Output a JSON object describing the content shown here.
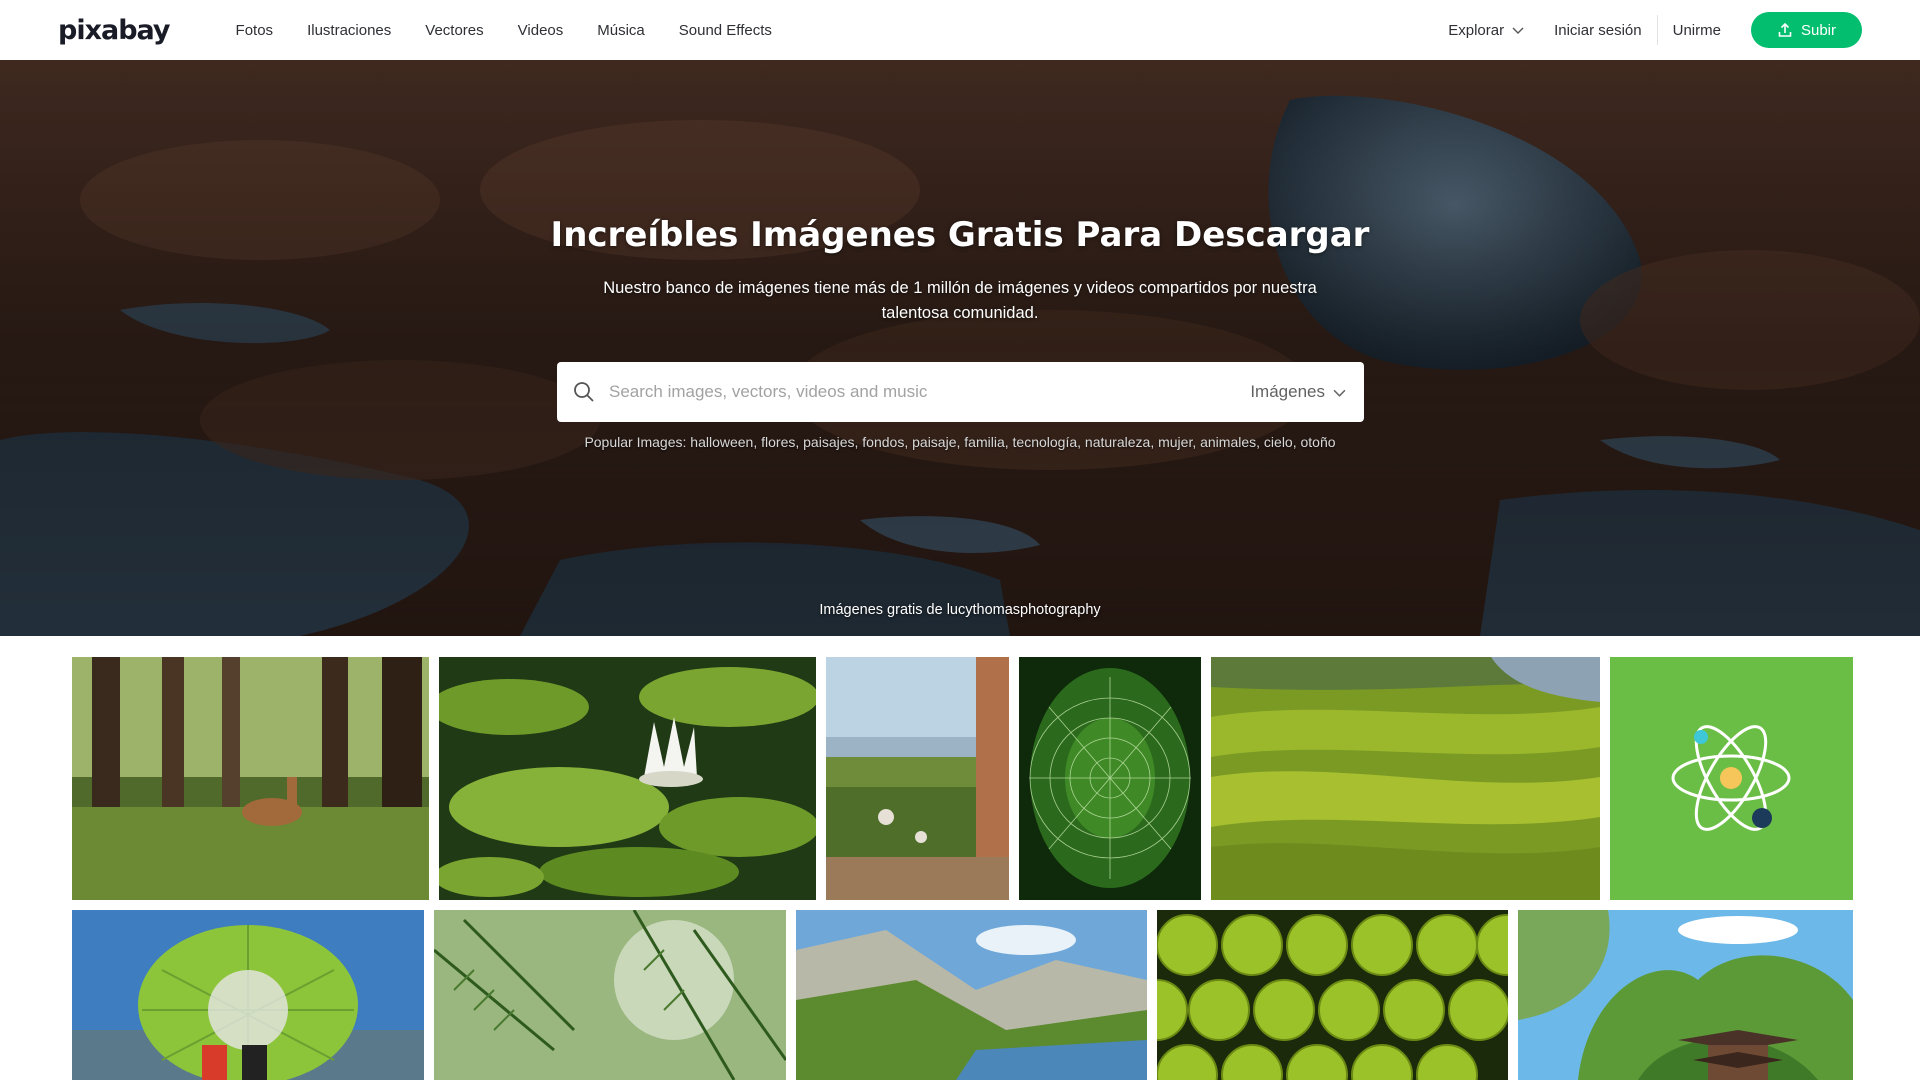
{
  "header": {
    "logo": "pixabay",
    "nav": [
      "Fotos",
      "Ilustraciones",
      "Vectores",
      "Videos",
      "Música",
      "Sound Effects"
    ],
    "explore_label": "Explorar",
    "login_label": "Iniciar sesión",
    "join_label": "Unirme",
    "upload_label": "Subir"
  },
  "hero": {
    "title": "Increíbles Imágenes Gratis Para Descargar",
    "subtitle": "Nuestro banco de imágenes tiene más de 1 millón de imágenes y videos compartidos por nuestra talentosa comunidad.",
    "search": {
      "placeholder": "Search images, vectors, videos and music",
      "type_label": "Imágenes"
    },
    "popular_prefix": "Popular Images:",
    "popular_tags": [
      "halloween",
      "flores",
      "paisajes",
      "fondos",
      "paisaje",
      "familia",
      "tecnología",
      "naturaleza",
      "mujer",
      "animales",
      "cielo",
      "otoño"
    ],
    "credit": "Imágenes gratis de lucythomasphotography"
  },
  "gallery": {
    "thumbnails": [
      "forest-deer",
      "water-lily",
      "valley-view",
      "spider-web",
      "rice-terraces",
      "atom-illustration",
      "green-hot-air-balloon",
      "pine-branch",
      "mountain-lake",
      "green-apples",
      "pagoda-illustration"
    ]
  },
  "colors": {
    "accent": "#02BE6E",
    "nav_text": "#2f3035",
    "atom_bg": "#6BBE45"
  }
}
